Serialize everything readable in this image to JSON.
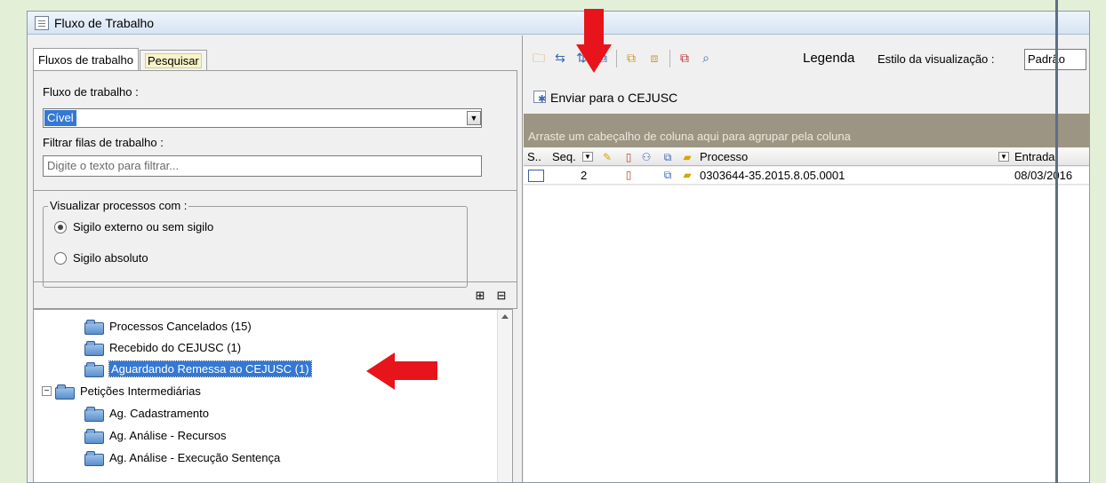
{
  "window": {
    "title": "Fluxo de Trabalho"
  },
  "left": {
    "tabs": [
      "Fluxos de trabalho",
      "Pesquisar"
    ],
    "fluxo_label": "Fluxo de trabalho :",
    "fluxo_value": "Cível",
    "filtrar_label": "Filtrar filas de trabalho :",
    "filtrar_placeholder": "Digite o texto para filtrar...",
    "visualizar_label": "Visualizar processos com :",
    "radio_options": [
      "Sigilo externo ou sem sigilo",
      "Sigilo absoluto"
    ],
    "tree": [
      "Processos Cancelados (15)",
      "Recebido do CEJUSC (1)",
      "Aguardando Remessa ao CEJUSC (1)",
      "Petições Intermediárias",
      "Ag. Cadastramento",
      "Ag. Análise - Recursos",
      "Ag. Análise - Execução Sentença"
    ]
  },
  "right": {
    "toolbar": {
      "legenda": "Legenda",
      "estilo_label": "Estilo da visualização :",
      "estilo_value": "Padrão"
    },
    "send_action": "Enviar para o CEJUSC",
    "group_hint": "Arraste um cabeçalho de coluna aqui para agrupar pela coluna",
    "columns": {
      "s": "S..",
      "seq": "Seq.",
      "processo": "Processo",
      "entrada": "Entrada"
    },
    "row": {
      "seq": "2",
      "processo": "0303644-35.2015.8.05.0001",
      "entrada": "08/03/2016"
    }
  },
  "colors": {
    "selection": "#3478d4",
    "arrow": "#e8141b",
    "group_header": "#9c9583"
  }
}
